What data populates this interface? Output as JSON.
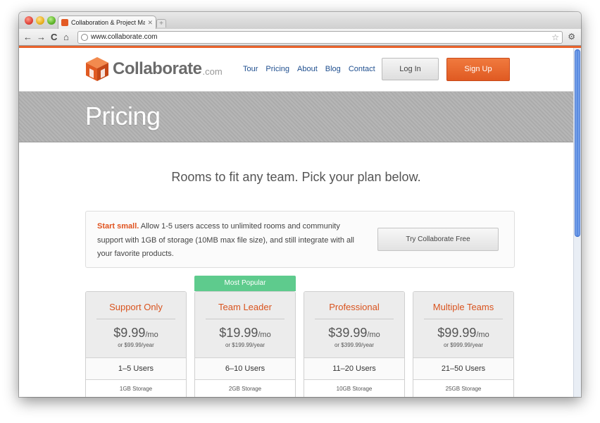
{
  "browser": {
    "tab_title": "Collaboration & Project Man",
    "tab_close": "✕",
    "new_tab": "+",
    "url": "www.collaborate.com",
    "back": "←",
    "forward": "→",
    "reload": "C",
    "home": "⌂",
    "star": "☆",
    "wrench": "🔧"
  },
  "header": {
    "logo_word": "Collaborate",
    "logo_com": ".com",
    "nav": [
      "Tour",
      "Pricing",
      "About",
      "Blog",
      "Contact"
    ],
    "login_label": "Log In",
    "signup_label": "Sign Up"
  },
  "banner": {
    "title": "Pricing"
  },
  "tagline": "Rooms to fit any team. Pick your plan below.",
  "free_box": {
    "highlight": "Start small.",
    "text": " Allow 1-5 users access to unlimited rooms and community support with 1GB of storage (10MB max file size), and still integrate with all your favorite products.",
    "button": "Try Collaborate Free"
  },
  "popular_badge": "Most Popular",
  "plans": [
    {
      "name": "Support Only",
      "price": "$9.99",
      "per": "/mo",
      "yearly": "or $99.99/year",
      "users": "1–5 Users",
      "storage": "1GB Storage"
    },
    {
      "name": "Team Leader",
      "price": "$19.99",
      "per": "/mo",
      "yearly": "or $199.99/year",
      "users": "6–10 Users",
      "storage": "2GB Storage"
    },
    {
      "name": "Professional",
      "price": "$39.99",
      "per": "/mo",
      "yearly": "or $399.99/year",
      "users": "11–20 Users",
      "storage": "10GB Storage"
    },
    {
      "name": "Multiple Teams",
      "price": "$99.99",
      "per": "/mo",
      "yearly": "or $999.99/year",
      "users": "21–50 Users",
      "storage": "25GB Storage"
    }
  ],
  "colors": {
    "accent": "#e05a22",
    "popular": "#5ecb8d",
    "link": "#1f4f8f",
    "banner": "#b2b2b2"
  }
}
